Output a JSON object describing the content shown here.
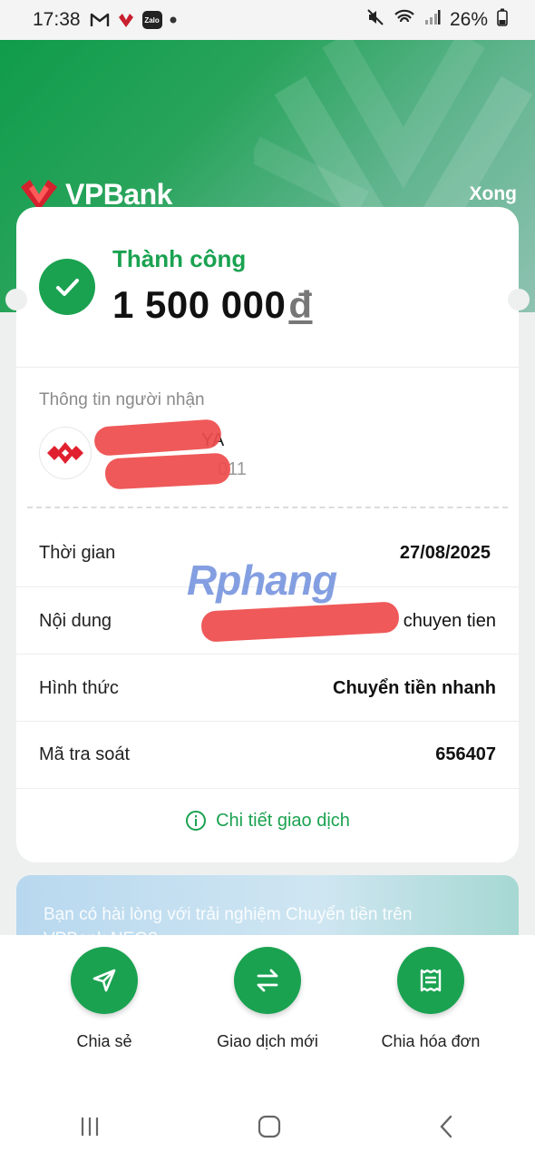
{
  "status_bar": {
    "time": "17:38",
    "battery": "26%"
  },
  "header": {
    "brand": "VPBank",
    "done_label": "Xong",
    "brand_color": "#1aa251"
  },
  "result": {
    "status": "Thành công",
    "amount": "1 500 000",
    "currency": "đ"
  },
  "recipient": {
    "section_label": "Thông tin người nhận",
    "name_visible": "YA",
    "account_visible": "011"
  },
  "details": [
    {
      "label": "Thời gian",
      "value": "27/08/2025"
    },
    {
      "label": "Nội dung",
      "value": "chuyen tien"
    },
    {
      "label": "Hình thức",
      "value": "Chuyển tiền nhanh"
    },
    {
      "label": "Mã tra soát",
      "value": "656407"
    }
  ],
  "detail_link": "Chi tiết giao dịch",
  "watermark": "Rphang",
  "banner": {
    "text_line1": "Bạn có hài lòng với trải nghiệm Chuyển tiền trên",
    "text_line2": "VPBank NEO?"
  },
  "actions": [
    {
      "label": "Chia sẻ",
      "icon": "send-icon"
    },
    {
      "label": "Giao dịch mới",
      "icon": "swap-arrows-icon"
    },
    {
      "label": "Chia hóa đơn",
      "icon": "receipt-icon"
    }
  ]
}
